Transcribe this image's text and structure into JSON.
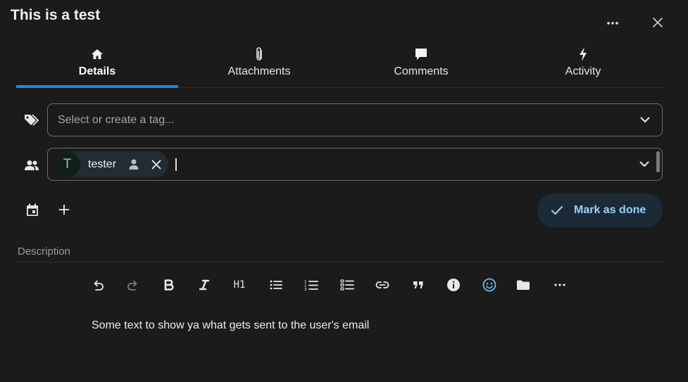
{
  "header": {
    "title": "This is a test"
  },
  "tabs": [
    {
      "label": "Details",
      "icon": "home-icon",
      "active": true
    },
    {
      "label": "Attachments",
      "icon": "paperclip-icon",
      "active": false
    },
    {
      "label": "Comments",
      "icon": "comment-icon",
      "active": false
    },
    {
      "label": "Activity",
      "icon": "lightning-icon",
      "active": false
    }
  ],
  "tags": {
    "placeholder": "Select or create a tag..."
  },
  "assignees": {
    "items": [
      {
        "initial": "T",
        "name": "tester"
      }
    ]
  },
  "actions": {
    "mark_done_label": "Mark as done"
  },
  "description": {
    "label": "Description",
    "content": "Some text to show ya what gets sent to the user's email"
  },
  "toolbar": {
    "heading_label": "H1",
    "buttons": [
      "undo-icon",
      "redo-icon",
      "bold-icon",
      "italic-icon",
      "heading-1",
      "bullet-list-icon",
      "numbered-list-icon",
      "task-list-icon",
      "link-icon",
      "quote-icon",
      "info-icon",
      "emoji-icon",
      "folder-icon",
      "more-icon"
    ]
  },
  "colors": {
    "background": "#1b1b1c",
    "accent": "#1e88e5",
    "mark_done_bg": "#1c2a38",
    "mark_done_text": "#9ccff4",
    "emoji_icon": "#6cb7ec"
  }
}
